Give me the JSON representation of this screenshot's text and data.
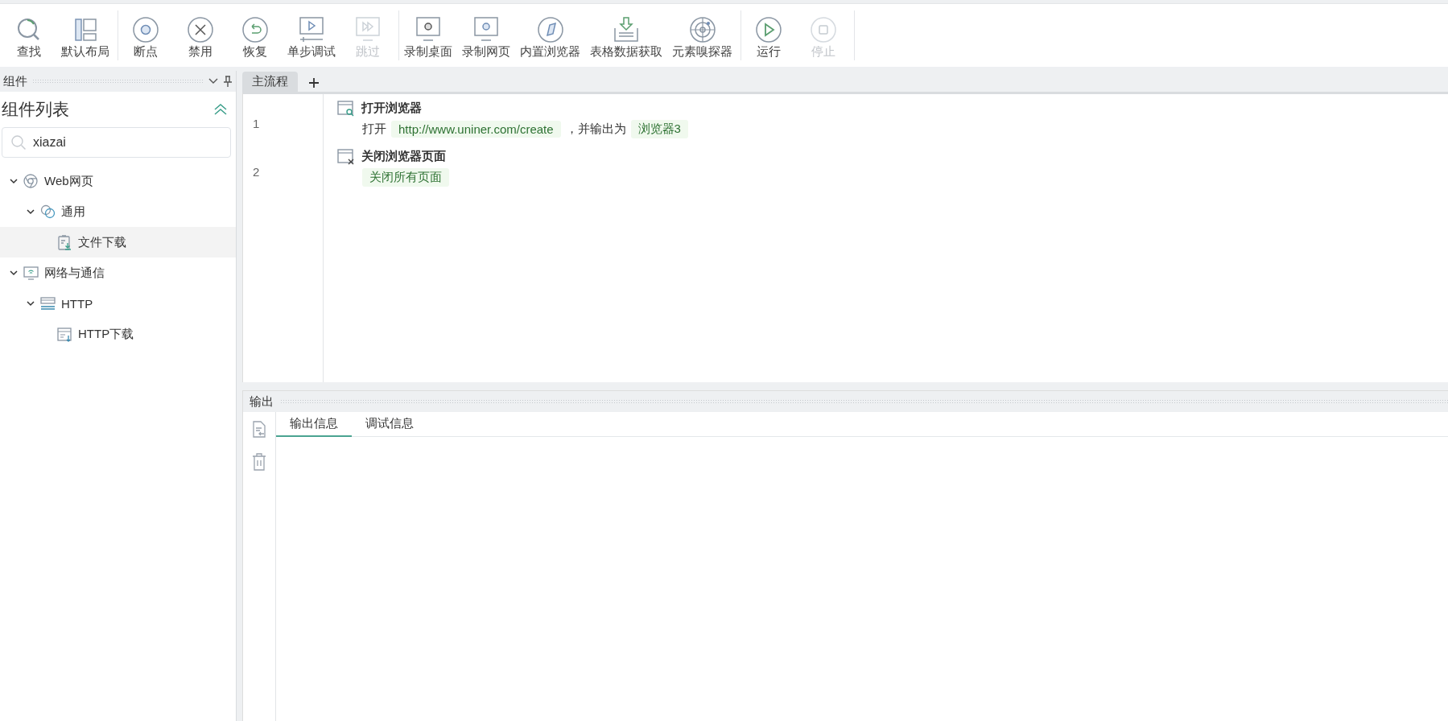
{
  "toolbar": {
    "groups": [
      [
        {
          "label": "查找",
          "kind": "search",
          "disabled": false
        },
        {
          "label": "默认布局",
          "kind": "layout",
          "disabled": false
        }
      ],
      [
        {
          "label": "断点",
          "kind": "breakpoint",
          "disabled": false
        },
        {
          "label": "禁用",
          "kind": "disable",
          "disabled": false
        },
        {
          "label": "恢复",
          "kind": "restore",
          "disabled": false
        },
        {
          "label": "单步调试",
          "kind": "step",
          "disabled": false
        },
        {
          "label": "跳过",
          "kind": "skip",
          "disabled": true
        }
      ],
      [
        {
          "label": "录制桌面",
          "kind": "desktop",
          "disabled": false
        },
        {
          "label": "录制网页",
          "kind": "web",
          "disabled": false
        },
        {
          "label": "内置浏览器",
          "kind": "browser",
          "disabled": false
        },
        {
          "label": "表格数据获取",
          "kind": "table",
          "disabled": false
        },
        {
          "label": "元素嗅探器",
          "kind": "sniffer",
          "disabled": false
        }
      ],
      [
        {
          "label": "运行",
          "kind": "run",
          "disabled": false
        },
        {
          "label": "停止",
          "kind": "stop",
          "disabled": true
        }
      ]
    ]
  },
  "components_panel": {
    "title": "组件",
    "heading": "组件列表",
    "search": {
      "value": "xiazai"
    },
    "tree": [
      {
        "label": "Web网页",
        "kind": "web",
        "expanded": true,
        "selected": false,
        "children": [
          {
            "label": "通用",
            "kind": "general",
            "expanded": true,
            "selected": false,
            "children": [
              {
                "label": "文件下载",
                "kind": "download",
                "selected": true
              }
            ]
          }
        ]
      },
      {
        "label": "网络与通信",
        "kind": "network",
        "expanded": true,
        "selected": false,
        "children": [
          {
            "label": "HTTP",
            "kind": "server",
            "expanded": true,
            "selected": false,
            "children": [
              {
                "label": "HTTP下载",
                "kind": "request",
                "selected": false
              }
            ]
          }
        ]
      }
    ]
  },
  "editor": {
    "tabs": [
      {
        "label": "主流程",
        "selected": true
      }
    ],
    "steps": [
      {
        "line": "1",
        "title": "打开浏览器",
        "kind": "open",
        "params": [
          {
            "kind": "text",
            "text": "打开"
          },
          {
            "kind": "tag",
            "text": "http://www.uniner.com/create"
          },
          {
            "kind": "text",
            "text": "，并输出为"
          },
          {
            "kind": "tag",
            "text": "浏览器3"
          }
        ]
      },
      {
        "line": "2",
        "title": "关闭浏览器页面",
        "kind": "close",
        "params": [
          {
            "kind": "tag",
            "text": "关闭所有页面"
          }
        ]
      }
    ]
  },
  "output_panel": {
    "title": "输出",
    "tabs": [
      {
        "label": "输出信息",
        "selected": true
      },
      {
        "label": "调试信息",
        "selected": false
      }
    ]
  }
}
